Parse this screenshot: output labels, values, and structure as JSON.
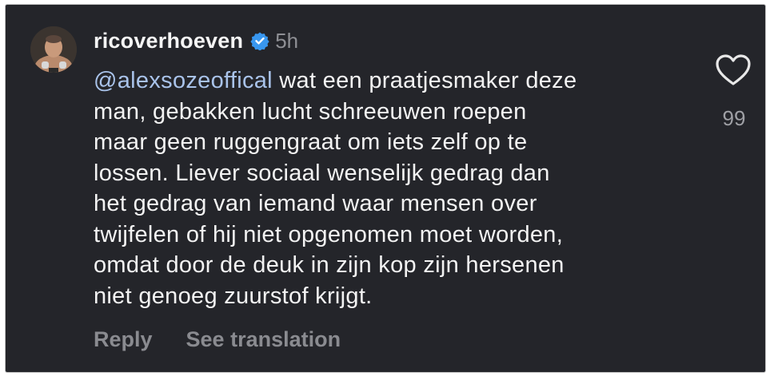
{
  "comment": {
    "username": "ricoverhoeven",
    "verified": true,
    "timestamp": "5h",
    "mention": "@alexsozeoffical",
    "lines": [
      " wat een praatjesmaker deze",
      "man, gebakken lucht schreeuwen roepen",
      "maar geen ruggengraat om iets zelf op te",
      "lossen. Liever sociaal wenselijk gedrag dan",
      "het gedrag van iemand waar mensen over",
      "twijfelen of hij niet opgenomen moet worden,",
      "omdat door de deuk in zijn kop zijn hersenen",
      "niet genoeg zuurstof krijgt."
    ],
    "like_count": "99"
  },
  "actions": {
    "reply_label": "Reply",
    "translate_label": "See translation"
  },
  "icons": {
    "like": "heart-icon",
    "verified": "verified-badge-icon"
  },
  "colors": {
    "background": "#24252a",
    "mention": "#a9c3ea",
    "verified": "#3897f0",
    "secondary_text": "#8a8b90"
  }
}
